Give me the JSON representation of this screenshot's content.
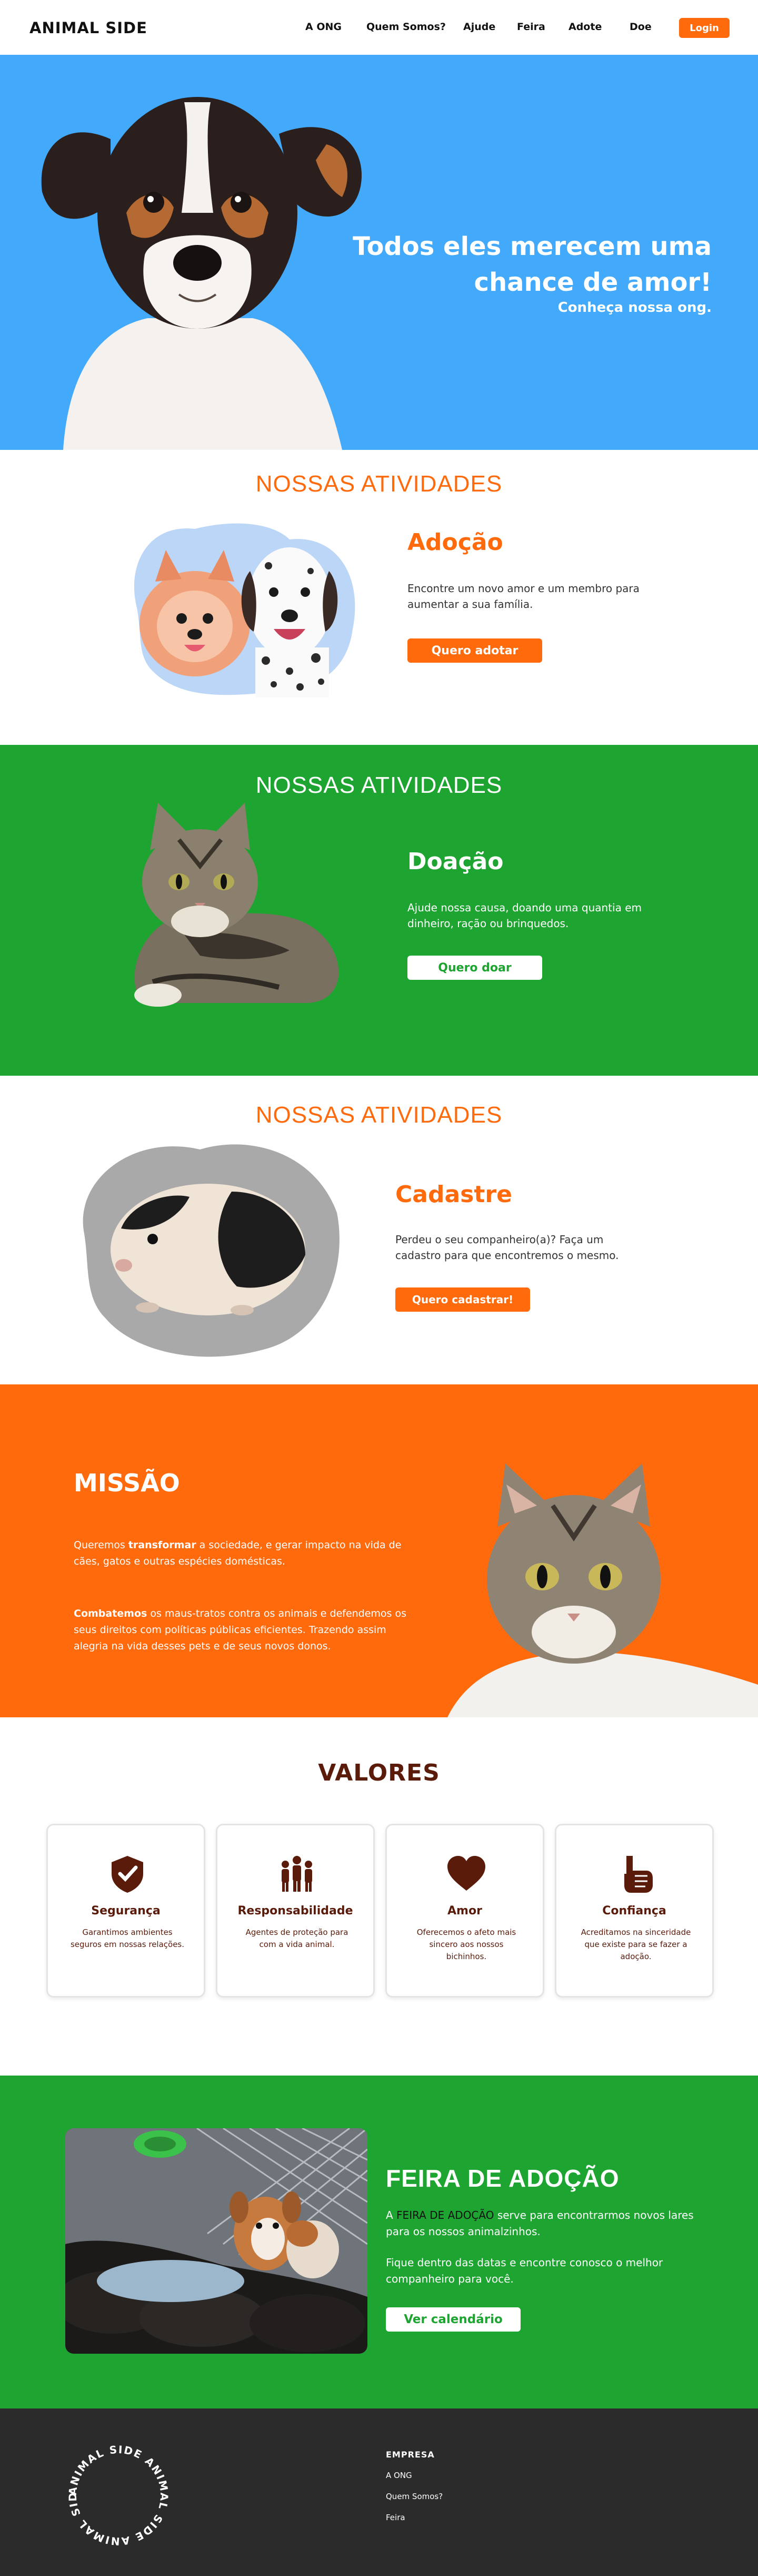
{
  "header": {
    "logo": "ANIMAL SIDE",
    "nav": [
      "A ONG",
      "Quem Somos?",
      "Ajude",
      "Feira",
      "Adote",
      "Doe"
    ],
    "login": "Login"
  },
  "hero": {
    "title": "Todos eles merecem uma chance de amor!",
    "subtitle": "Conheça nossa ong."
  },
  "activities": [
    {
      "section_title": "NOSSAS ATIVIDADES",
      "heading": "Adoção",
      "text": "Encontre um novo amor e um membro para aumentar a sua família.",
      "button": "Quero adotar"
    },
    {
      "section_title": "NOSSAS ATIVIDADES",
      "heading": "Doação",
      "text": "Ajude nossa causa, doando uma quantia em dinheiro, ração ou brinquedos.",
      "button": "Quero doar"
    },
    {
      "section_title": "NOSSAS ATIVIDADES",
      "heading": "Cadastre",
      "text": "Perdeu o seu companheiro(a)? Faça um cadastro para que encontremos o mesmo.",
      "button": "Quero cadastrar!"
    }
  ],
  "mission": {
    "title": "MISSÃO",
    "p1_pre": "Queremos ",
    "p1_bold": "transformar",
    "p1_post": " a sociedade, e gerar impacto na vida de cães, gatos e outras espécies domésticas.",
    "p2_bold": "Combatemos",
    "p2_post": " os maus-tratos contra os animais e defendemos os seus direitos com políticas públicas eficientes. Trazendo assim alegria na vida desses pets e de seus novos donos."
  },
  "values": {
    "title": "VALORES",
    "cards": [
      {
        "icon": "shield-check-icon",
        "title": "Segurança",
        "text": "Garantimos ambientes seguros em nossas relações."
      },
      {
        "icon": "people-icon",
        "title": "Responsabilidade",
        "text": "Agentes de proteção para com a vida animal."
      },
      {
        "icon": "heart-icon",
        "title": "Amor",
        "text": "Oferecemos o afeto mais sincero aos nossos bichinhos."
      },
      {
        "icon": "pinky-promise-icon",
        "title": "Confiança",
        "text": "Acreditamos na sinceridade que existe para se fazer a adoção."
      }
    ]
  },
  "fair": {
    "title": "FEIRA DE ADOÇÃO",
    "p1_pre": "A ",
    "p1_hl": "FEIRA DE ADOÇÃO",
    "p1_post": " serve para encontrarmos novos lares para os nossos animalzinhos.",
    "p2": "Fique dentro das datas e encontre conosco o melhor companheiro para você.",
    "button": "Ver calendário"
  },
  "footer": {
    "badge_text": "ANIMAL SIDE ANIMAL SIDE ANIMAL SIDE",
    "heading": "EMPRESA",
    "links": [
      "A ONG",
      "Quem Somos?",
      "Feira"
    ]
  },
  "colors": {
    "blue": "#43a9fb",
    "orange": "#ff6a0d",
    "green": "#1ea431",
    "brown": "#5a1b0b",
    "dark": "#2b2b2b"
  }
}
